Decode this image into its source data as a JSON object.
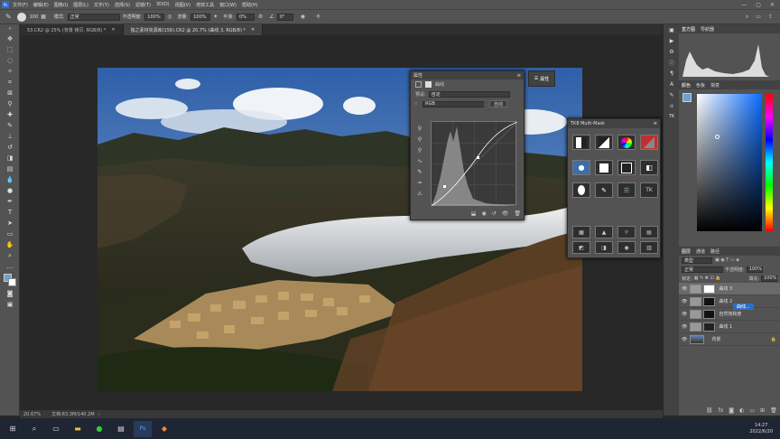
{
  "menu": [
    "文件(F)",
    "编辑(E)",
    "图像(I)",
    "图层(L)",
    "文字(Y)",
    "选择(S)",
    "滤镜(T)",
    "3D(D)",
    "视图(V)",
    "增效工具",
    "窗口(W)",
    "帮助(H)"
  ],
  "options": {
    "brush_size": "100",
    "mode_label": "模式:",
    "mode_value": "正常",
    "opacity_label": "不透明度:",
    "opacity_value": "100%",
    "flow_label": "流量:",
    "flow_value": "100%",
    "smooth_label": "平滑:",
    "smooth_value": "0%",
    "angle_value": "0°"
  },
  "tabs": [
    "53.CR2 @ 25% (背景 拷贝, RGB/8) *",
    "独之素材资源库(156).CR2 @ 20.7% (曲线 3, RGB/8) *"
  ],
  "status": {
    "zoom": "20.67%",
    "doc": "文档:63.3M/140.2M"
  },
  "properties": {
    "title": "属性",
    "adjust": "曲线",
    "preset_label": "预设:",
    "preset_value": "自定",
    "channel": "RGB",
    "auto_button": "自动",
    "tab_label": "属性"
  },
  "tk": {
    "title": "TK8 Multi-Mask"
  },
  "histogram": {
    "tabs": [
      "直方图",
      "导航器"
    ]
  },
  "color": {
    "tabs": [
      "颜色",
      "色板",
      "渐变"
    ]
  },
  "layers": {
    "tabs": [
      "图层",
      "通道",
      "路径"
    ],
    "kind": "类型",
    "blend": "正常",
    "opacity_label": "不透明度:",
    "opacity_value": "100%",
    "lock_label": "锁定:",
    "fill_label": "填充:",
    "fill_value": "100%",
    "rows": [
      "曲线 3",
      "曲线 2",
      "自然饱和度",
      "曲线 1",
      "背景"
    ],
    "tooltip": "曲线..."
  },
  "clock": {
    "time": "14:27",
    "date": "2022/6/20"
  }
}
